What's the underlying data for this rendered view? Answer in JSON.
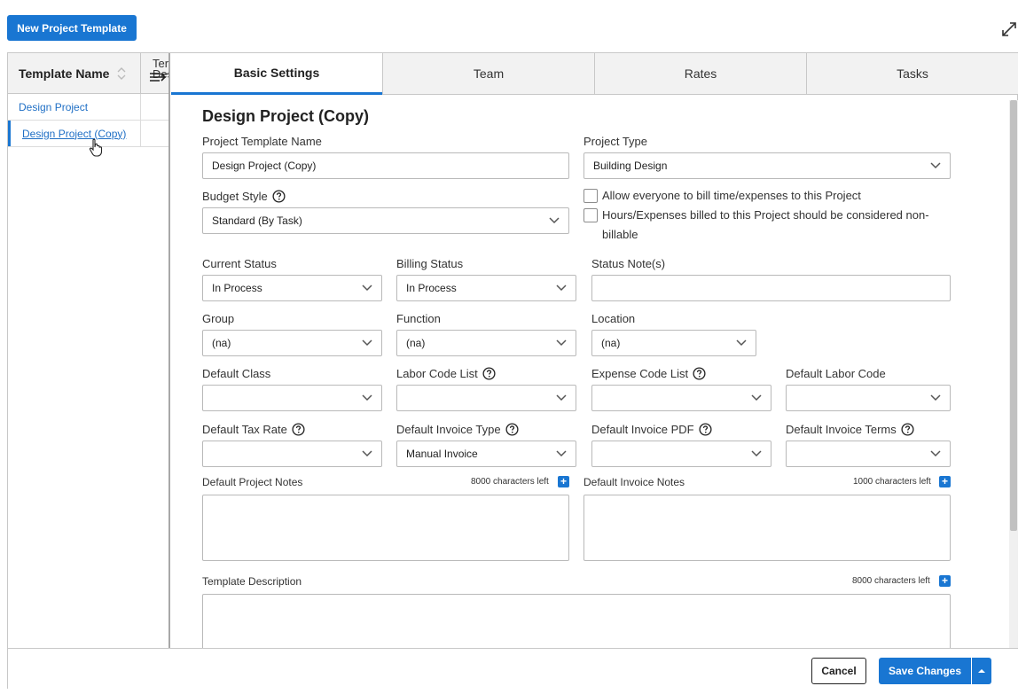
{
  "toolbar": {
    "new_template_label": "New Project Template"
  },
  "template_list": {
    "col_name": "Template Name",
    "col_desc_line1": "Ter",
    "col_desc_line2": "Des",
    "rows": [
      "Design Project",
      "Design Project (Copy)"
    ]
  },
  "tabs": [
    "Basic Settings",
    "Team",
    "Rates",
    "Tasks"
  ],
  "form": {
    "heading": "Design Project (Copy)",
    "template_name": {
      "label": "Project Template Name",
      "value": "Design Project (Copy)"
    },
    "project_type": {
      "label": "Project Type",
      "value": "Building Design"
    },
    "budget_style": {
      "label": "Budget Style",
      "value": "Standard (By Task)"
    },
    "allow_everyone": "Allow everyone to bill time/expenses to this Project",
    "non_billable_line1": "Hours/Expenses billed to this Project should be considered non-",
    "non_billable_line2": "billable",
    "current_status": {
      "label": "Current Status",
      "value": "In Process"
    },
    "billing_status": {
      "label": "Billing Status",
      "value": "In Process"
    },
    "status_notes": {
      "label": "Status Note(s)",
      "value": ""
    },
    "group": {
      "label": "Group",
      "value": "(na)"
    },
    "function": {
      "label": "Function",
      "value": "(na)"
    },
    "location": {
      "label": "Location",
      "value": "(na)"
    },
    "default_class": {
      "label": "Default Class",
      "value": ""
    },
    "labor_code_list": {
      "label": "Labor Code List",
      "value": ""
    },
    "expense_code_list": {
      "label": "Expense Code List",
      "value": ""
    },
    "default_labor_code": {
      "label": "Default Labor Code",
      "value": ""
    },
    "default_tax_rate": {
      "label": "Default Tax Rate",
      "value": ""
    },
    "default_invoice_type": {
      "label": "Default Invoice Type",
      "value": "Manual Invoice"
    },
    "default_invoice_pdf": {
      "label": "Default Invoice PDF",
      "value": ""
    },
    "default_invoice_terms": {
      "label": "Default Invoice Terms",
      "value": ""
    },
    "project_notes": {
      "label": "Default Project Notes",
      "counter": "8000 characters left"
    },
    "invoice_notes": {
      "label": "Default Invoice Notes",
      "counter": "1000 characters left"
    },
    "template_description": {
      "label": "Template Description",
      "counter": "8000 characters left"
    },
    "plus_glyph": "+"
  },
  "footer": {
    "cancel_label": "Cancel",
    "save_label": "Save Changes"
  },
  "colors": {
    "primary": "#1976d2",
    "link": "#1f6fc5",
    "border": "#b9b9b9"
  }
}
